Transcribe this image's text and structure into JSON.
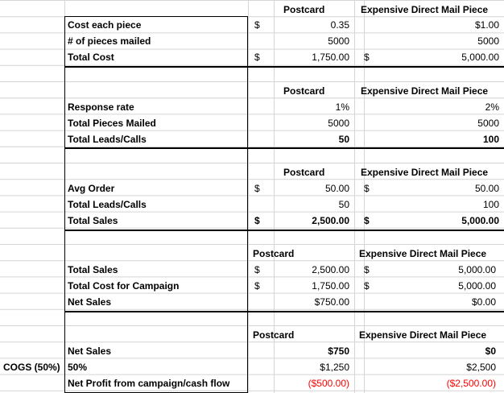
{
  "sections": [
    {
      "headers": {
        "postcard": "Postcard",
        "mail": "Expensive Direct Mail Piece"
      },
      "rows": [
        {
          "label": "Cost each piece",
          "pc_sym": "$",
          "pc_val": "0.35",
          "dm_sym": "",
          "dm_val": "$1.00"
        },
        {
          "label": "# of pieces mailed",
          "pc_sym": "",
          "pc_val": "5000",
          "dm_sym": "",
          "dm_val": "5000"
        },
        {
          "label": "Total Cost",
          "pc_sym": "$",
          "pc_val": "1,750.00",
          "dm_sym": "$",
          "dm_val": "5,000.00"
        }
      ]
    },
    {
      "headers": {
        "postcard": "Postcard",
        "mail": "Expensive Direct Mail Piece"
      },
      "rows": [
        {
          "label": "Response rate",
          "pc_sym": "",
          "pc_val": "1%",
          "dm_sym": "",
          "dm_val": "2%"
        },
        {
          "label": "Total Pieces Mailed",
          "pc_sym": "",
          "pc_val": "5000",
          "dm_sym": "",
          "dm_val": "5000"
        },
        {
          "label": "Total Leads/Calls",
          "pc_sym": "",
          "pc_val": "50",
          "dm_sym": "",
          "dm_val": "100"
        }
      ]
    },
    {
      "headers": {
        "postcard": "Postcard",
        "mail": "Expensive Direct Mail Piece"
      },
      "rows": [
        {
          "label": "Avg Order",
          "pc_sym": "$",
          "pc_val": "50.00",
          "dm_sym": "$",
          "dm_val": "50.00"
        },
        {
          "label": "Total Leads/Calls",
          "pc_sym": "",
          "pc_val": "50",
          "dm_sym": "",
          "dm_val": "100"
        },
        {
          "label": "Total Sales",
          "pc_sym": "$",
          "pc_val": "2,500.00",
          "dm_sym": "$",
          "dm_val": "5,000.00"
        }
      ]
    },
    {
      "headers": {
        "postcard": "Postcard",
        "mail": "Expensive Direct Mail Piece"
      },
      "rows": [
        {
          "label": "Total Sales",
          "pc_sym": "$",
          "pc_val": "2,500.00",
          "dm_sym": "$",
          "dm_val": "5,000.00"
        },
        {
          "label": "Total Cost for Campaign",
          "pc_sym": "$",
          "pc_val": "1,750.00",
          "dm_sym": "$",
          "dm_val": "5,000.00"
        },
        {
          "label": "Net Sales",
          "pc_sym": "",
          "pc_val": "$750.00",
          "dm_sym": "",
          "dm_val": "$0.00"
        }
      ]
    },
    {
      "headers": {
        "postcard": "Postcard",
        "mail": "Expensive Direct Mail Piece"
      },
      "rows": [
        {
          "label": "Net Sales",
          "pc_sym": "",
          "pc_val": "$750",
          "dm_sym": "",
          "dm_val": "$0"
        },
        {
          "label": "50%",
          "pc_sym": "",
          "pc_val": "$1,250",
          "dm_sym": "",
          "dm_val": "$2,500"
        },
        {
          "label": "Net Profit from campaign/cash flow",
          "pc_sym": "",
          "pc_val": "($500.00)",
          "dm_sym": "",
          "dm_val": "($2,500.00)"
        }
      ]
    }
  ],
  "cogs_label": "COGS (50%)",
  "colors": {
    "grid": "#d4d4d4",
    "negative": "#ff0000",
    "text": "#000000"
  }
}
